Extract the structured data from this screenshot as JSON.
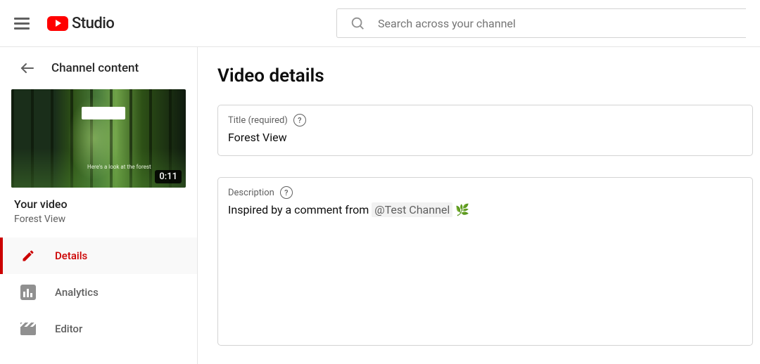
{
  "header": {
    "logo_text": "Studio",
    "search_placeholder": "Search across your channel"
  },
  "sidebar": {
    "back_label": "Channel content",
    "video_duration": "0:11",
    "overlay_caption": "Here's a look\nat the forest",
    "your_video_heading": "Your video",
    "video_title": "Forest View",
    "menu": [
      {
        "key": "details",
        "label": "Details",
        "active": true
      },
      {
        "key": "analytics",
        "label": "Analytics",
        "active": false
      },
      {
        "key": "editor",
        "label": "Editor",
        "active": false
      }
    ]
  },
  "main": {
    "page_heading": "Video details",
    "title_field": {
      "label": "Title (required)",
      "value": "Forest View"
    },
    "description_field": {
      "label": "Description",
      "value_prefix": "Inspired by a comment from ",
      "mention": "@Test Channel",
      "emoji": "🌿"
    }
  }
}
